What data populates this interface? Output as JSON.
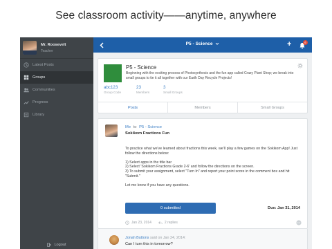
{
  "headline": "See classroom activity——anytime, anywhere",
  "profile": {
    "name": "Mr. Roosevelt",
    "role": "Teacher"
  },
  "sidebar": {
    "items": [
      {
        "label": "Latest Posts",
        "icon": "latest-posts-icon"
      },
      {
        "label": "Groups",
        "icon": "groups-icon",
        "active": true
      },
      {
        "label": "Communities",
        "icon": "communities-icon"
      },
      {
        "label": "Progress",
        "icon": "progress-icon"
      },
      {
        "label": "Library",
        "icon": "library-icon"
      }
    ],
    "logout_label": "Logout"
  },
  "topbar": {
    "title": "P5 - Science",
    "notification_count": "6"
  },
  "group": {
    "title": "P5 - Science",
    "description": "Beginning with the exciting process of Photosynthesis and the fun app called Crazy Plant Shop; we break into small groups to tie it all together with our Earth Day Recycle Projects!",
    "stats": [
      {
        "value": "abc123",
        "label": "Group Code"
      },
      {
        "value": "23",
        "label": "Members"
      },
      {
        "value": "3",
        "label": "Small Groups"
      }
    ],
    "tabs": [
      "Posts",
      "Members",
      "Small Groups"
    ],
    "active_tab": "Posts"
  },
  "post": {
    "author": "Me",
    "to_word": "to",
    "target": "P5 - Science",
    "title": "Sokikom Fractions Fun",
    "body": [
      "To practice what we've learned about fractions this week, we'll play a few games on the Sokikom App! Just follow the directions below:",
      "1) Select apps in the title bar\n2) Select 'Sokikom Fractions Grade 2-6' and follow the directions on the screen.\n3) To submit your assignment, select \"Turn In\" and report your point score in the comment box and hit \"Submit.\"",
      "Let me know if you have any questions."
    ],
    "submit_label": "0 submitted",
    "due": "Due: Jan 31, 2014",
    "date": "Jan 23, 2014",
    "replies": "2 replies"
  },
  "reply": {
    "author": "Jonah Buttons",
    "said": "said on Jan 24, 2014:",
    "text": "Can I turn this in tomorrow?"
  },
  "colors": {
    "accent": "#1e5fa8",
    "sidebar_bg": "#3f4448",
    "group_image": "#2f8d3c",
    "badge": "#e04b3a"
  }
}
